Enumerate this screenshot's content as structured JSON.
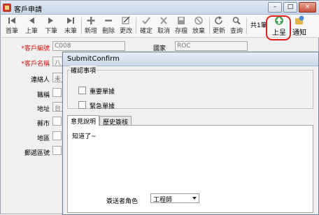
{
  "window": {
    "title": "客戶申請"
  },
  "toolbar": {
    "buttons": [
      {
        "label": "首筆",
        "icon": "first-record-icon"
      },
      {
        "label": "上筆",
        "icon": "previous-record-icon"
      },
      {
        "label": "下筆",
        "icon": "next-record-icon"
      },
      {
        "label": "末筆",
        "icon": "last-record-icon"
      },
      {
        "label": "新增",
        "icon": "add-icon"
      },
      {
        "label": "刪除",
        "icon": "delete-icon"
      },
      {
        "label": "更改",
        "icon": "edit-icon"
      },
      {
        "label": "確定",
        "icon": "confirm-icon"
      },
      {
        "label": "取消",
        "icon": "cancel-icon"
      },
      {
        "label": "存檔",
        "icon": "save-icon"
      },
      {
        "label": "放棄",
        "icon": "discard-icon"
      },
      {
        "label": "更新",
        "icon": "refresh-icon"
      },
      {
        "label": "查詢",
        "icon": "search-icon"
      }
    ],
    "record_count": "共1筆",
    "submit_label": "上呈",
    "notify_label": "通知"
  },
  "form": {
    "customer_no_label": "*客戶編號",
    "customer_no_value": "C008",
    "customer_name_label": "*客戶名稱",
    "customer_name_value": "八",
    "country_label": "國家",
    "country_value": "ROC",
    "contact_label": "連絡人",
    "contact_value": "未",
    "title_label": "職稱",
    "address_label": "地址",
    "address_value": "台",
    "city_label": "縣市",
    "region_label": "地區",
    "postal_label": "郵遞區號"
  },
  "dialog": {
    "title": "SubmitConfirm",
    "group_title": "確認事項",
    "checkbox_important": "重要單據",
    "checkbox_urgent": "緊急單據",
    "tab_opinion": "意見說明",
    "tab_history": "歷史簽核",
    "note_text": "知道了~",
    "role_label": "簽送者角色",
    "role_value": "工程師"
  }
}
